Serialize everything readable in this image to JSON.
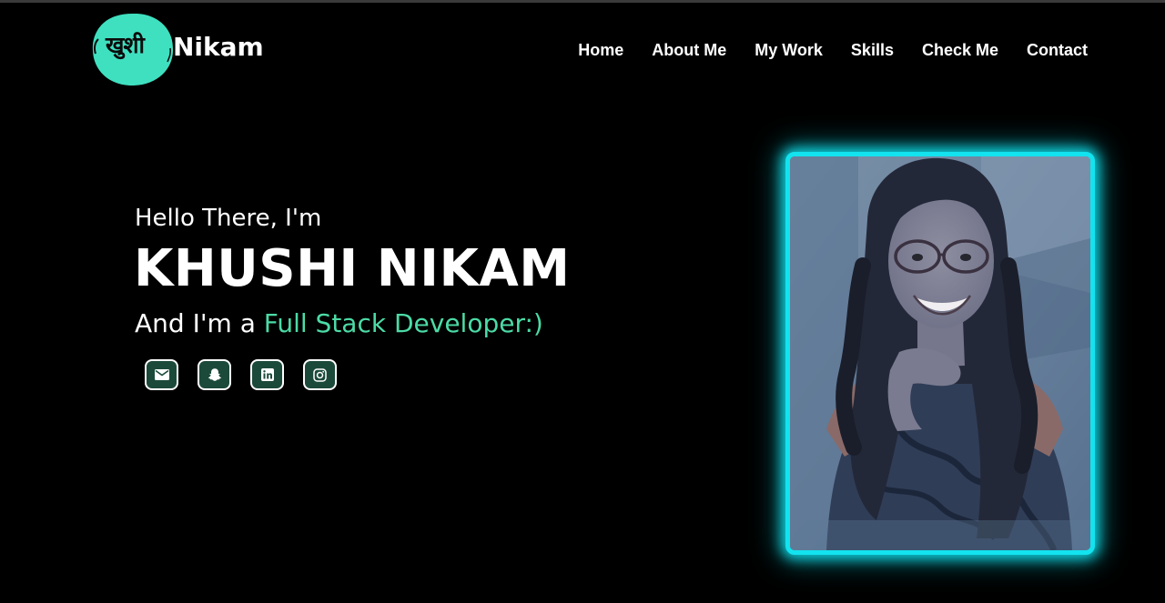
{
  "brand": {
    "logo_devanagari": "खुशी",
    "logo_latin": "Nikam",
    "accent_color": "#3fe0c0"
  },
  "nav": {
    "items": [
      {
        "label": "Home"
      },
      {
        "label": "About Me"
      },
      {
        "label": "My Work"
      },
      {
        "label": "Skills"
      },
      {
        "label": "Check Me"
      },
      {
        "label": "Contact"
      }
    ]
  },
  "hero": {
    "greeting": "Hello There, I'm",
    "name": "KHUSHI NIKAM",
    "role_prefix": "And I'm a ",
    "role": "Full Stack Developer:)",
    "role_color": "#4cdba6"
  },
  "socials": [
    {
      "icon": "mail-icon"
    },
    {
      "icon": "snapchat-icon"
    },
    {
      "icon": "linkedin-icon"
    },
    {
      "icon": "instagram-icon"
    }
  ],
  "portrait": {
    "frame_color": "#12e3ef"
  }
}
